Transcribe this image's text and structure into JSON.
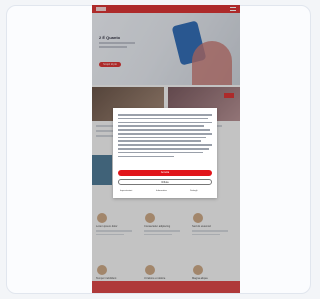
{
  "hero": {
    "title": "2 É Quanto",
    "cta": "Scopri di più"
  },
  "grid": [
    {
      "label": "Lorem ipsum dolor"
    },
    {
      "label": "Consectetur adipiscing"
    },
    {
      "label": "Sed do eiusmod"
    },
    {
      "label": "Tempor incididunt"
    },
    {
      "label": "Ut labore et dolore"
    },
    {
      "label": "Magna aliqua"
    }
  ],
  "cookie_dialog": {
    "accept_label": "Accetta",
    "necessary_label": "Rifiuta",
    "options": [
      "Impostazioni",
      "Informativa",
      "Dettagli"
    ]
  },
  "colors": {
    "brand_red": "#d62020",
    "background": "#f3f5f8"
  }
}
